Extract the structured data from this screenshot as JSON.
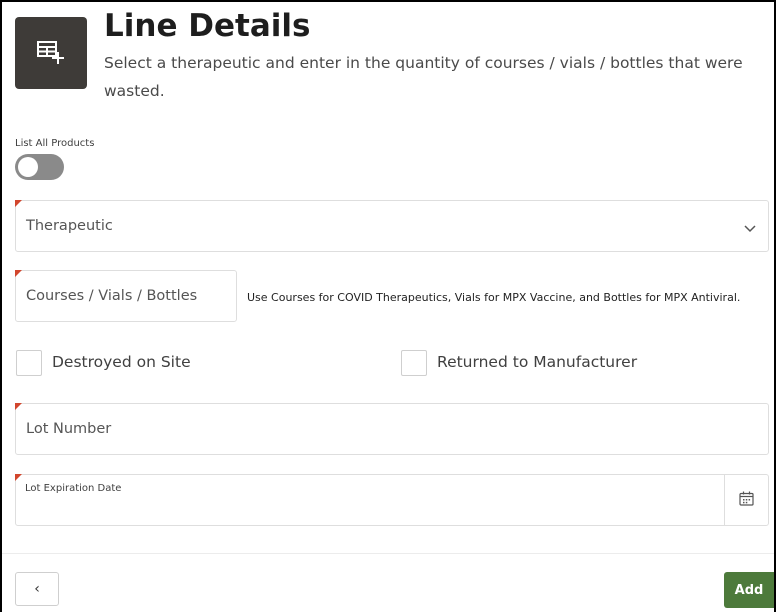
{
  "header": {
    "icon": "table-add-icon",
    "title": "Line Details",
    "subtitle": "Select a therapeutic and enter in the quantity of courses / vials / bottles that were wasted."
  },
  "toggle": {
    "label": "List All Products",
    "checked": false
  },
  "therapeutic": {
    "placeholder": "Therapeutic",
    "icon": "chevron-down-icon"
  },
  "quantity": {
    "placeholder": "Courses / Vials / Bottles",
    "hint": "Use Courses for COVID Therapeutics, Vials for MPX Vaccine, and Bottles for MPX Antiviral."
  },
  "checkboxes": {
    "destroyed_label": "Destroyed on Site",
    "returned_label": "Returned to Manufacturer"
  },
  "lot_number": {
    "placeholder": "Lot Number"
  },
  "lot_expiration": {
    "label": "Lot Expiration Date",
    "icon": "calendar-icon"
  },
  "footer": {
    "back_label": "‹",
    "add_label": "Add"
  },
  "colors": {
    "header_icon_bg": "#3e3b38",
    "required_marker": "#d2462d",
    "add_button": "#4d7a3b",
    "toggle_off": "#8a8a8a"
  }
}
